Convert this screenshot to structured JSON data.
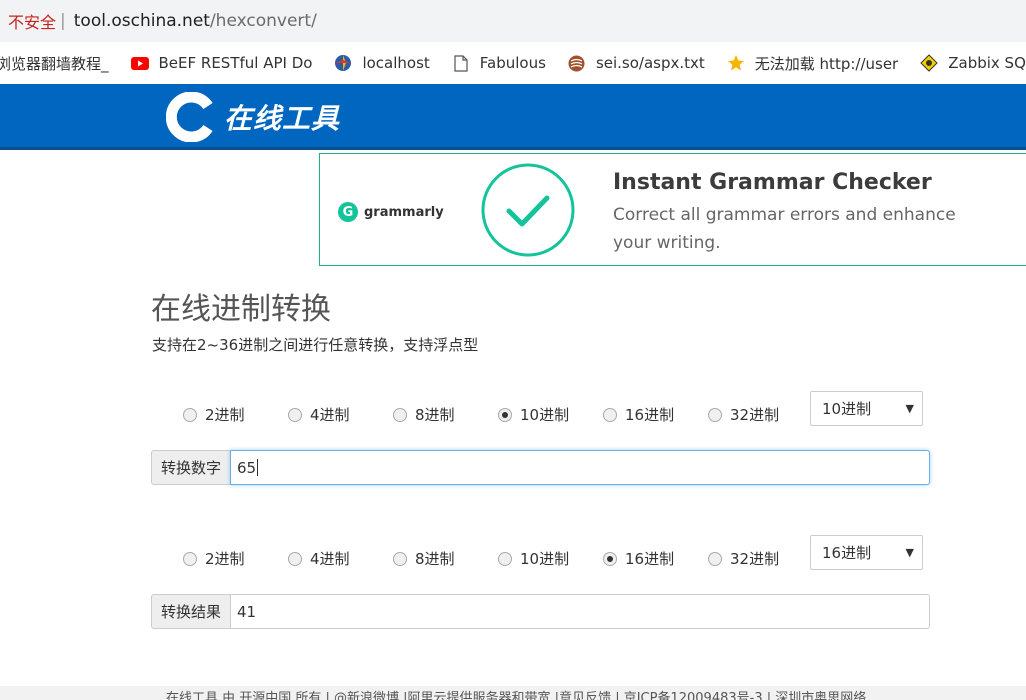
{
  "browser": {
    "security_label": "不安全",
    "url_host": "tool.oschina.net",
    "url_path": "/hexconvert/"
  },
  "bookmarks": [
    {
      "icon": "page-icon",
      "label": "浏览器翻墙教程_"
    },
    {
      "icon": "youtube-icon",
      "label": "BeEF RESTful API Do"
    },
    {
      "icon": "localhost-icon",
      "label": "localhost"
    },
    {
      "icon": "page-icon",
      "label": "Fabulous"
    },
    {
      "icon": "sei-icon",
      "label": "sei.so/aspx.txt"
    },
    {
      "icon": "star-icon",
      "label": "无法加载 http://user"
    },
    {
      "icon": "zabbix-icon",
      "label": "Zabbix SQL Inje"
    }
  ],
  "header": {
    "logo_text": "在线工具",
    "brand_color": "#0066c0"
  },
  "ad": {
    "brand": "grammarly",
    "title": "Instant Grammar Checker",
    "body": "Correct all grammar errors and enhance your writing.",
    "accent": "#15c39a"
  },
  "main": {
    "title": "在线进制转换",
    "subtitle": "支持在2~36进制之间进行任意转换，支持浮点型",
    "source_radios": [
      {
        "label": "2进制",
        "checked": false
      },
      {
        "label": "4进制",
        "checked": false
      },
      {
        "label": "8进制",
        "checked": false
      },
      {
        "label": "10进制",
        "checked": true
      },
      {
        "label": "16进制",
        "checked": false
      },
      {
        "label": "32进制",
        "checked": false
      }
    ],
    "source_select": "10进制",
    "input_label": "转换数字",
    "input_value": "65",
    "target_radios": [
      {
        "label": "2进制",
        "checked": false
      },
      {
        "label": "4进制",
        "checked": false
      },
      {
        "label": "8进制",
        "checked": false
      },
      {
        "label": "10进制",
        "checked": false
      },
      {
        "label": "16进制",
        "checked": true
      },
      {
        "label": "32进制",
        "checked": false
      }
    ],
    "target_select": "16进制",
    "result_label": "转换结果",
    "result_value": "41"
  },
  "footer": {
    "text": "在线工具 由 开源中国 所有 | @新浪微博 |阿里云提供服务器和带宽 |意见反馈 | 京ICP备12009483号-3 | 深圳市奥思网络"
  }
}
